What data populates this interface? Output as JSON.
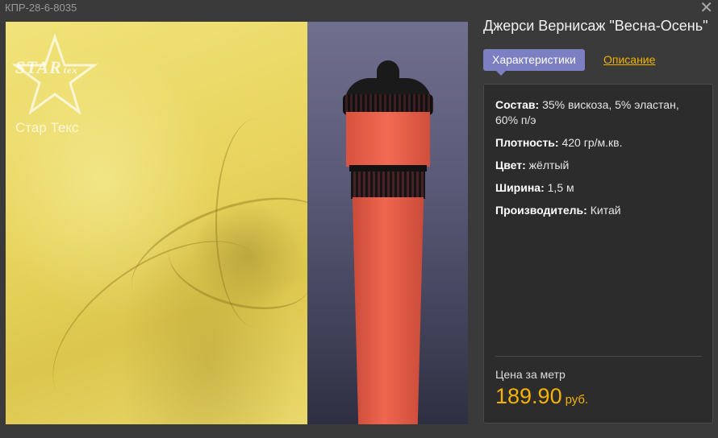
{
  "sku": "КПР-28-6-8035",
  "close_icon": "close-icon",
  "product": {
    "title": "Джерси Вернисаж \"Весна-Осень\""
  },
  "tabs": {
    "characteristics": "Характеристики",
    "description": "Описание"
  },
  "logo": {
    "brand": "STAR",
    "brand_small": "tex",
    "sub": "Стар Текс"
  },
  "specs": [
    {
      "label": "Состав:",
      "value": "35% вискоза, 5% эластан, 60% п/э"
    },
    {
      "label": "Плотность:",
      "value": "420 гр/м.кв."
    },
    {
      "label": "Цвет:",
      "value": "жёлтый"
    },
    {
      "label": "Ширина:",
      "value": "1,5 м"
    },
    {
      "label": "Производитель:",
      "value": "Китай"
    }
  ],
  "price": {
    "label": "Цена за метр",
    "value": "189.90",
    "currency": "руб."
  },
  "colors": {
    "accent_tab": "#7d7fc3",
    "price": "#f5b200",
    "link": "#f0b400"
  }
}
